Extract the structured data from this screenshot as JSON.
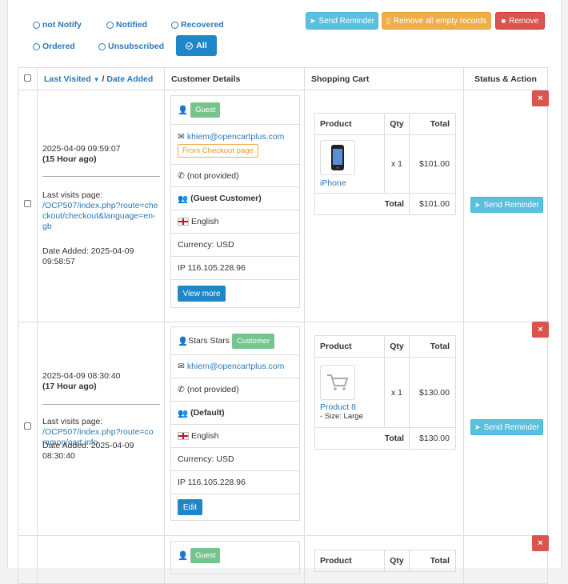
{
  "filters": {
    "not_notify": "not Notify",
    "notified": "Notified",
    "recovered": "Recovered",
    "ordered": "Ordered",
    "unsubscribed": "Unsubscribed",
    "all": "All"
  },
  "toolbar": {
    "send_reminder": "Send Reminder",
    "remove_empty": "Remove all empty records",
    "remove": "Remove"
  },
  "table": {
    "col_last_visited": "Last Visited",
    "col_sep": "/",
    "col_date_added": "Date Added",
    "col_customer": "Customer Details",
    "col_cart": "Shopping Cart",
    "col_status": "Status & Action"
  },
  "cart_headers": {
    "product": "Product",
    "qty": "Qty",
    "total": "Total",
    "total_label": "Total"
  },
  "rows": [
    {
      "last_visited": "2025-04-09 09:59:07",
      "ago": "(15 Hour ago)",
      "visits_label": "Last visits page:",
      "visits_url": "/OCP507/index.php?route=checkout/checkout&language=en-gb",
      "date_added": "Date Added: 2025-04-09 09:58:57",
      "name": "",
      "badge": "Guest",
      "email": "khiem@opencartplus.com",
      "origin": "From Checkout page",
      "phone": "(not provided)",
      "group": "(Guest Customer)",
      "language": "English",
      "currency": "Currency: USD",
      "ip": "IP 116.105.228.96",
      "action": "View more",
      "product": "iPhone",
      "option": "",
      "qty": "x 1",
      "price": "$101.00",
      "cart_total": "$101.00",
      "send": "Send Reminder",
      "close": "×"
    },
    {
      "last_visited": "2025-04-09 08:30:40",
      "ago": "(17 Hour ago)",
      "visits_label": "Last visits page:",
      "visits_url": "/OCP507/index.php?route=common/cart.info",
      "date_added": "Date Added: 2025-04-09 08:30:40",
      "name": "Stars Stars",
      "badge": "Customer",
      "email": "khiem@opencartplus.com",
      "phone": "(not provided)",
      "group": "(Default)",
      "language": "English",
      "currency": "Currency: USD",
      "ip": "IP 116.105.228.96",
      "action": "Edit",
      "product": "Product 8",
      "option": "- Size: Large",
      "qty": "x 1",
      "price": "$130.00",
      "cart_total": "$130.00",
      "send": "Send Reminder",
      "close": "×"
    },
    {
      "badge": "Guest",
      "close": "×"
    }
  ]
}
